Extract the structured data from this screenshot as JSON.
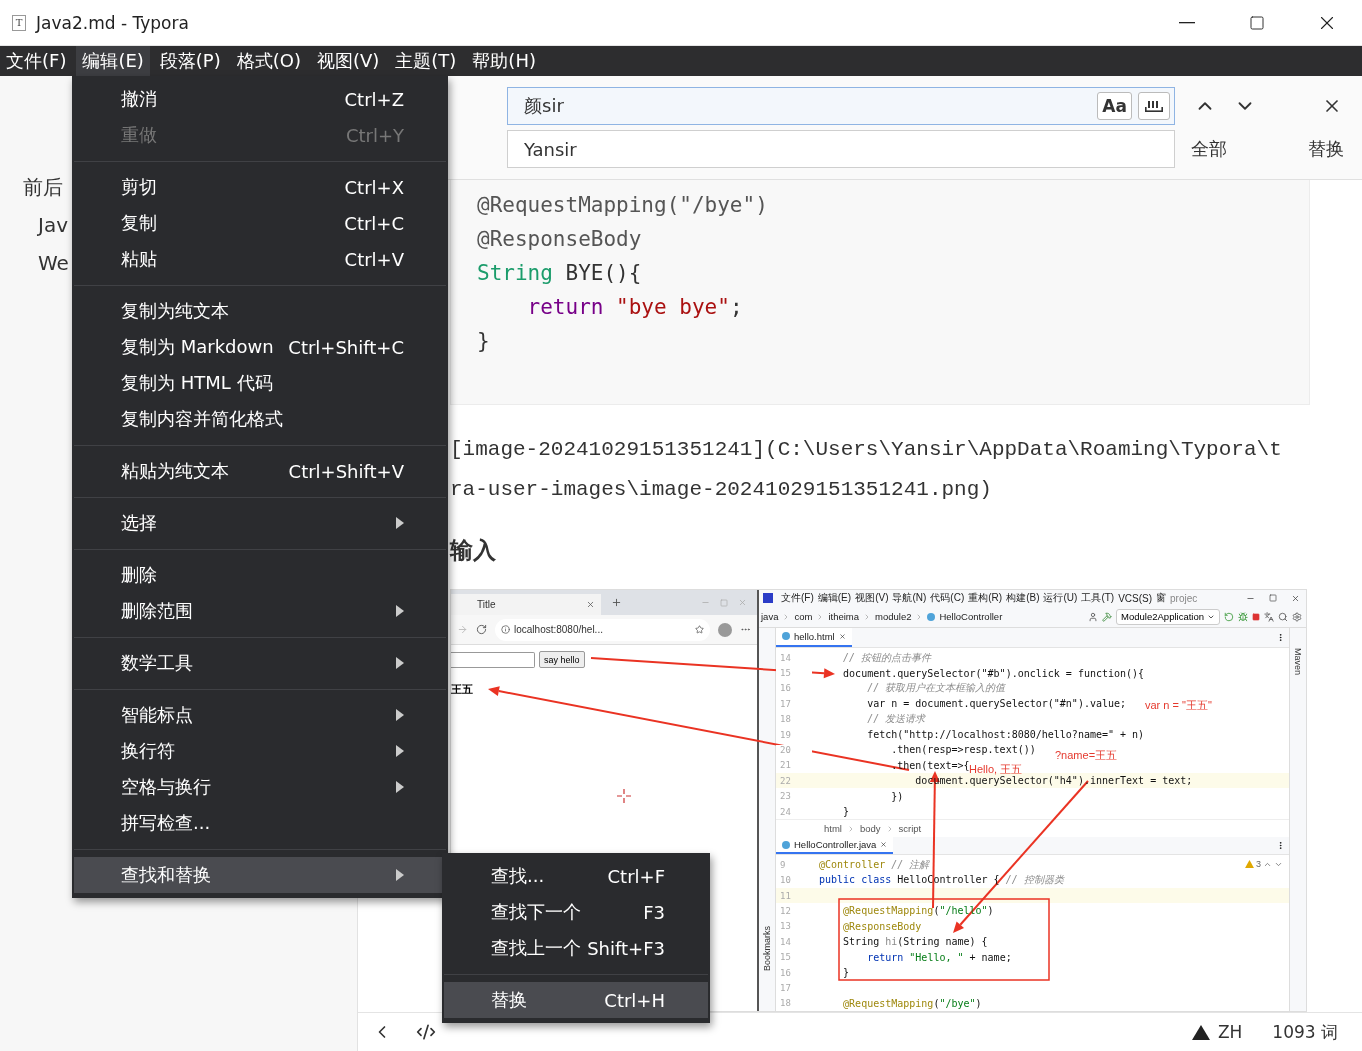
{
  "window": {
    "logo": "T",
    "title": "Java2.md - Typora"
  },
  "menubar": [
    {
      "label": "文件(F)",
      "selected": false
    },
    {
      "label": "编辑(E)",
      "selected": true
    },
    {
      "label": "段落(P)",
      "selected": false
    },
    {
      "label": "格式(O)",
      "selected": false
    },
    {
      "label": "视图(V)",
      "selected": false
    },
    {
      "label": "主题(T)",
      "selected": false
    },
    {
      "label": "帮助(H)",
      "selected": false
    }
  ],
  "edit_menu": [
    {
      "kind": "item",
      "label": "撤消",
      "shortcut": "Ctrl+Z",
      "disabled": false,
      "selected": false
    },
    {
      "kind": "item",
      "label": "重做",
      "shortcut": "Ctrl+Y",
      "disabled": true,
      "selected": false
    },
    {
      "kind": "separator"
    },
    {
      "kind": "item",
      "label": "剪切",
      "shortcut": "Ctrl+X",
      "disabled": false,
      "selected": false
    },
    {
      "kind": "item",
      "label": "复制",
      "shortcut": "Ctrl+C",
      "disabled": false,
      "selected": false
    },
    {
      "kind": "item",
      "label": "粘贴",
      "shortcut": "Ctrl+V",
      "disabled": false,
      "selected": false
    },
    {
      "kind": "separator"
    },
    {
      "kind": "item",
      "label": "复制为纯文本",
      "disabled": false,
      "selected": false
    },
    {
      "kind": "item",
      "label": "复制为 Markdown",
      "shortcut": "Ctrl+Shift+C",
      "disabled": false,
      "selected": false
    },
    {
      "kind": "item",
      "label": "复制为 HTML 代码",
      "disabled": false,
      "selected": false
    },
    {
      "kind": "item",
      "label": "复制内容并简化格式",
      "disabled": false,
      "selected": false
    },
    {
      "kind": "separator"
    },
    {
      "kind": "item",
      "label": "粘贴为纯文本",
      "shortcut": "Ctrl+Shift+V",
      "disabled": false,
      "selected": false
    },
    {
      "kind": "separator"
    },
    {
      "kind": "submenu",
      "label": "选择",
      "disabled": false,
      "selected": false
    },
    {
      "kind": "separator"
    },
    {
      "kind": "item",
      "label": "删除",
      "disabled": false,
      "selected": false
    },
    {
      "kind": "submenu",
      "label": "删除范围",
      "disabled": false,
      "selected": false
    },
    {
      "kind": "separator"
    },
    {
      "kind": "submenu",
      "label": "数学工具",
      "disabled": false,
      "selected": false
    },
    {
      "kind": "separator"
    },
    {
      "kind": "submenu",
      "label": "智能标点",
      "disabled": false,
      "selected": false
    },
    {
      "kind": "submenu",
      "label": "换行符",
      "disabled": false,
      "selected": false
    },
    {
      "kind": "submenu",
      "label": "空格与换行",
      "disabled": false,
      "selected": false
    },
    {
      "kind": "item",
      "label": "拼写检查...",
      "disabled": false,
      "selected": false
    },
    {
      "kind": "separator"
    },
    {
      "kind": "submenu",
      "label": "查找和替换",
      "disabled": false,
      "selected": true
    }
  ],
  "find_submenu": [
    {
      "kind": "item",
      "label": "查找...",
      "shortcut": "Ctrl+F",
      "selected": false
    },
    {
      "kind": "item",
      "label": "查找下一个",
      "shortcut": "F3",
      "selected": false
    },
    {
      "kind": "item",
      "label": "查找上一个",
      "shortcut": "Shift+F3",
      "selected": false
    },
    {
      "kind": "separator"
    },
    {
      "kind": "item",
      "label": "替换",
      "shortcut": "Ctrl+H",
      "selected": true
    }
  ],
  "sidebar": {
    "outline": [
      {
        "label": "前后",
        "children": [
          {
            "label": "Jav"
          },
          {
            "label": "We"
          }
        ]
      }
    ]
  },
  "find_bar": {
    "search": {
      "value": "颜sir"
    },
    "match_case": {
      "label": "Aa"
    },
    "replace": {
      "value": "Yansir"
    },
    "buttons": [
      {
        "label": "全部"
      },
      {
        "label": "替换"
      }
    ]
  },
  "code_block": {
    "lines": [
      [
        {
          "kind": "meta",
          "text": "@RequestMapping(\"/bye\")"
        }
      ],
      [
        {
          "kind": "meta",
          "text": "@ResponseBody"
        }
      ],
      [
        {
          "kind": "type",
          "text": "String"
        },
        {
          "kind": "plain",
          "text": " BYE(){"
        }
      ],
      [
        {
          "kind": "keyword",
          "text": "    return"
        },
        {
          "kind": "string",
          "text": " \"bye bye\""
        },
        {
          "kind": "plain",
          "text": ";"
        }
      ],
      [
        {
          "kind": "plain",
          "text": "}"
        }
      ]
    ]
  },
  "paragraph": {
    "lines": [
      "[image-20241029151351241](C:\\Users\\Yansir\\AppData\\Roaming\\Typora\\t",
      "ra-user-images\\image-20241029151351241.png)"
    ]
  },
  "heading": {
    "text": "输入"
  },
  "screenshot": {
    "browser": {
      "tab": "Title",
      "url": "localhost:8080/hel...",
      "button": "say hello",
      "result": "王五"
    },
    "ide": {
      "menu": [
        "文件(F)",
        "编辑(E)",
        "视图(V)",
        "导航(N)",
        "代码(C)",
        "重构(R)",
        "构建(B)",
        "运行(U)",
        "工具(T)",
        "VCS(S)",
        "窗"
      ],
      "project": "projec",
      "breadcrumb": [
        "java",
        "com",
        "itheima",
        "module2",
        "HelloController"
      ],
      "run_config": "Module2Application",
      "left_label": "Bookmarks",
      "right_label": "Maven",
      "panes": [
        {
          "tab": "hello.html",
          "breadcrumb": [
            "html",
            "body",
            "script"
          ],
          "lines": [
            {
              "number": "14",
              "current": false,
              "tokens": [
                {
                  "kind": "comment",
                  "text": "    // 按钮的点击事件"
                }
              ]
            },
            {
              "number": "15",
              "current": false,
              "tokens": [
                {
                  "kind": "plain",
                  "text": "    document.querySelector(\"#b\").onclick = function(){"
                }
              ]
            },
            {
              "number": "16",
              "current": false,
              "tokens": [
                {
                  "kind": "comment",
                  "text": "        // 获取用户在文本框输入的值"
                }
              ]
            },
            {
              "number": "17",
              "current": false,
              "tokens": [
                {
                  "kind": "plain",
                  "text": "        var n = document.querySelector(\"#n\").value;"
                }
              ]
            },
            {
              "number": "18",
              "current": false,
              "tokens": [
                {
                  "kind": "comment",
                  "text": "        // 发送请求"
                }
              ]
            },
            {
              "number": "19",
              "current": false,
              "tokens": [
                {
                  "kind": "plain",
                  "text": "        fetch(\"http://localhost:8080/hello?name=\" + n)"
                }
              ]
            },
            {
              "number": "20",
              "current": false,
              "tokens": [
                {
                  "kind": "plain",
                  "text": "            .then(resp=>resp.text())"
                }
              ]
            },
            {
              "number": "21",
              "current": false,
              "tokens": [
                {
                  "kind": "plain",
                  "text": "            .then(text=>{"
                }
              ]
            },
            {
              "number": "22",
              "current": true,
              "tokens": [
                {
                  "kind": "plain",
                  "text": "                document.querySelector(\"h4\").innerText = text;"
                }
              ]
            },
            {
              "number": "23",
              "current": false,
              "tokens": [
                {
                  "kind": "plain",
                  "text": "            })"
                }
              ]
            },
            {
              "number": "24",
              "current": false,
              "tokens": [
                {
                  "kind": "plain",
                  "text": "    }"
                }
              ]
            }
          ]
        },
        {
          "tab": "HelloController.java",
          "warnings": "3",
          "lines": [
            {
              "number": "9",
              "current": false,
              "tokens": [
                {
                  "kind": "annotation",
                  "text": "@Controller"
                },
                {
                  "kind": "comment",
                  "text": " // 注解"
                }
              ]
            },
            {
              "number": "10",
              "current": false,
              "tokens": [
                {
                  "kind": "keyword",
                  "text": "public class"
                },
                {
                  "kind": "plain",
                  "text": " HelloController { "
                },
                {
                  "kind": "comment",
                  "text": "// 控制器类"
                }
              ]
            },
            {
              "number": "11",
              "current": true
            },
            {
              "number": "12",
              "current": false,
              "tokens": [
                {
                  "kind": "annotation",
                  "text": "    @RequestMapping"
                },
                {
                  "kind": "plain",
                  "text": "("
                },
                {
                  "kind": "string",
                  "text": "\"/hello\""
                },
                {
                  "kind": "plain",
                  "text": ")"
                }
              ]
            },
            {
              "number": "13",
              "current": false,
              "tokens": [
                {
                  "kind": "annotation",
                  "text": "    @ResponseBody"
                }
              ]
            },
            {
              "number": "14",
              "current": false,
              "tokens": [
                {
                  "kind": "plain",
                  "text": "    String "
                },
                {
                  "kind": "unused",
                  "text": "hi"
                },
                {
                  "kind": "plain",
                  "text": "(String name) {"
                }
              ]
            },
            {
              "number": "15",
              "current": false,
              "tokens": [
                {
                  "kind": "keyword",
                  "text": "        return"
                },
                {
                  "kind": "string",
                  "text": " \"Hello, \""
                },
                {
                  "kind": "plain",
                  "text": " + name;"
                }
              ]
            },
            {
              "number": "16",
              "current": false,
              "tokens": [
                {
                  "kind": "plain",
                  "text": "    }"
                }
              ]
            },
            {
              "number": "17",
              "current": false
            },
            {
              "number": "18",
              "current": false,
              "tokens": [
                {
                  "kind": "annotation",
                  "text": "    @RequestMapping"
                },
                {
                  "kind": "plain",
                  "text": "("
                },
                {
                  "kind": "string",
                  "text": "\"/bye\""
                },
                {
                  "kind": "plain",
                  "text": ")"
                }
              ]
            }
          ]
        }
      ]
    },
    "annotations": [
      "var n = \"王五\"",
      "?name=王五",
      "Hello, 王五"
    ]
  },
  "status_bar": {
    "language": "ZH",
    "word_count": "1093 词"
  }
}
